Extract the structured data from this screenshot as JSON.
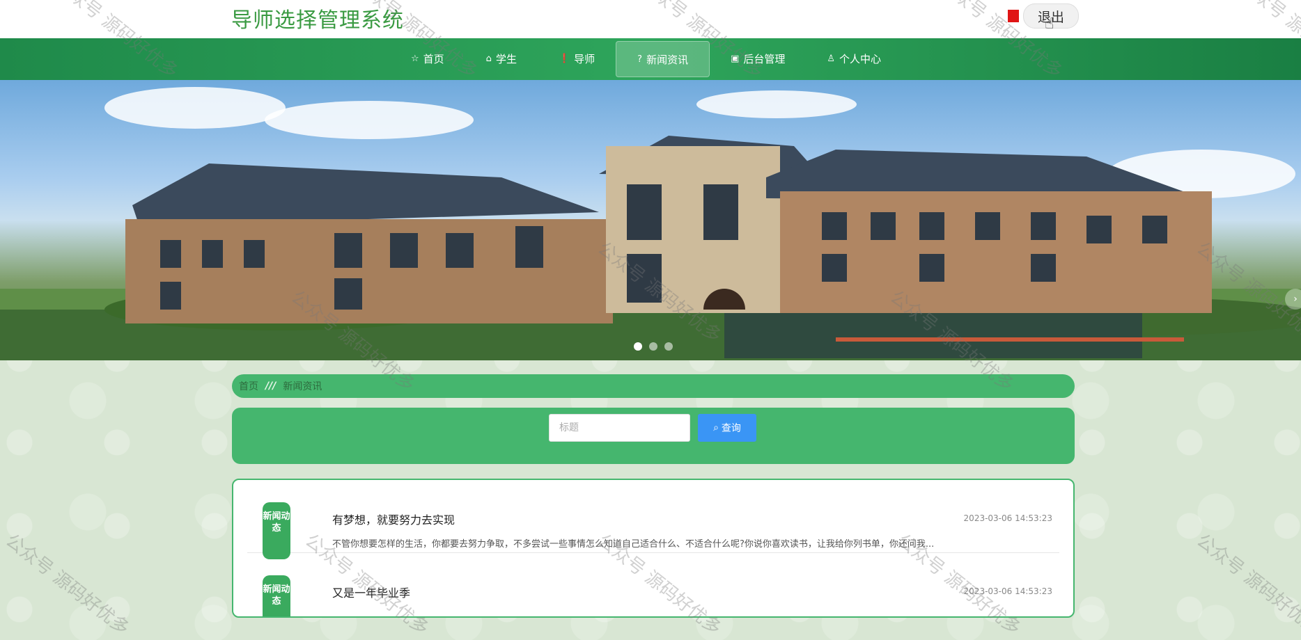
{
  "header": {
    "site_title": "导师选择管理系统",
    "logout_label": "退出"
  },
  "nav": {
    "items": [
      {
        "label": "首页",
        "icon": "star-icon",
        "glyph": "☆"
      },
      {
        "label": "学生",
        "icon": "bag-icon",
        "glyph": "⌂"
      },
      {
        "label": "导师",
        "icon": "info-icon",
        "glyph": "❗"
      },
      {
        "label": "新闻资讯",
        "icon": "help-icon",
        "glyph": "?",
        "active": true
      },
      {
        "label": "后台管理",
        "icon": "box-icon",
        "glyph": "▣"
      },
      {
        "label": "个人中心",
        "icon": "user-icon",
        "glyph": "♙"
      }
    ]
  },
  "banner": {
    "dots": 3,
    "active_dot": 0
  },
  "breadcrumb": {
    "home": "首页",
    "sep": "///",
    "current": "新闻资讯"
  },
  "search": {
    "placeholder": "标题",
    "button_label": "查询"
  },
  "news": [
    {
      "tag": "新闻动态",
      "title": "有梦想，就要努力去实现",
      "date": "2023-03-06 14:53:23",
      "summary": "不管你想要怎样的生活，你都要去努力争取，不多尝试一些事情怎么知道自己适合什么、不适合什么呢?你说你喜欢读书，让我给你列书单，你还问我..."
    },
    {
      "tag": "新闻动态",
      "title": "又是一年毕业季",
      "date": "2023-03-06 14:53:23",
      "summary": ""
    }
  ],
  "watermark": "公众号 源码好优多",
  "colors": {
    "brand_green": "#3a9a42",
    "nav_green": "#2ea55b",
    "panel_green": "#45b66e",
    "button_blue": "#3a95f5"
  }
}
